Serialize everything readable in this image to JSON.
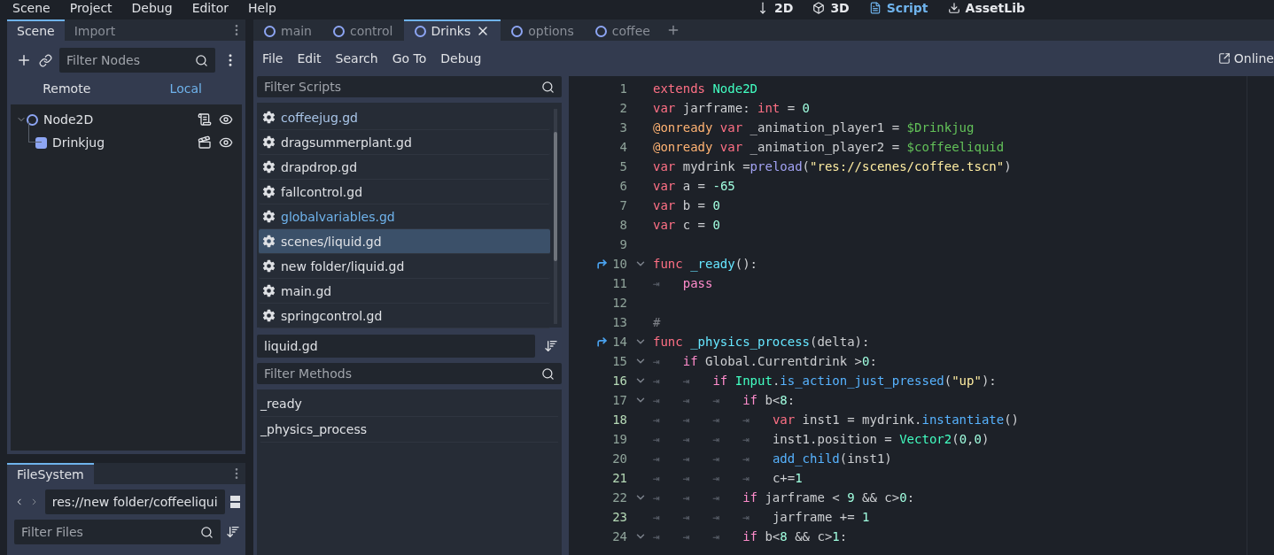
{
  "top_menu": [
    "Scene",
    "Project",
    "Debug",
    "Editor",
    "Help"
  ],
  "workspaces": [
    {
      "label": "2D",
      "kind": "canvas",
      "selected": false
    },
    {
      "label": "3D",
      "kind": "spatial",
      "selected": false
    },
    {
      "label": "Script",
      "kind": "script",
      "selected": true
    },
    {
      "label": "AssetLib",
      "kind": "assetlib",
      "selected": false
    }
  ],
  "scene_dock": {
    "tabs": [
      {
        "label": "Scene",
        "selected": true
      },
      {
        "label": "Import",
        "selected": false
      }
    ],
    "filter": {
      "placeholder": "Filter Nodes"
    },
    "modes": [
      {
        "label": "Remote",
        "selected": false
      },
      {
        "label": "Local",
        "selected": true
      }
    ],
    "tree": [
      {
        "name": "Node2D",
        "kind": "node2d",
        "has_script": true,
        "is_instance": false,
        "children": [
          {
            "name": "Drinkjug",
            "kind": "sprite",
            "has_script": false,
            "is_instance": true
          }
        ]
      }
    ]
  },
  "filesystem_dock": {
    "tabs": [
      {
        "label": "FileSystem",
        "selected": true
      }
    ],
    "path": "res://new folder/coffeeliqui",
    "filter": {
      "placeholder": "Filter Files"
    }
  },
  "script_tabs": [
    {
      "label": "main",
      "selected": false
    },
    {
      "label": "control",
      "selected": false
    },
    {
      "label": "Drinks",
      "selected": true
    },
    {
      "label": "options",
      "selected": false
    },
    {
      "label": "coffee",
      "selected": false
    }
  ],
  "script_menu": [
    "File",
    "Edit",
    "Search",
    "Go To",
    "Debug"
  ],
  "online_docs": "Online",
  "scripts_filter": {
    "placeholder": "Filter Scripts"
  },
  "scripts": [
    {
      "name": "coffeejug.gd",
      "color": "#a9c5e8",
      "selected": false
    },
    {
      "name": "dragsummerplant.gd",
      "color": "#dfe1e5",
      "selected": false
    },
    {
      "name": "drapdrop.gd",
      "color": "#dfe1e5",
      "selected": false
    },
    {
      "name": "fallcontrol.gd",
      "color": "#dfe1e5",
      "selected": false
    },
    {
      "name": "globalvariables.gd",
      "color": "#6fb3ec",
      "selected": false
    },
    {
      "name": "scenes/liquid.gd",
      "color": "#dfe1e5",
      "selected": true
    },
    {
      "name": "new folder/liquid.gd",
      "color": "#dfe1e5",
      "selected": false
    },
    {
      "name": "main.gd",
      "color": "#dfe1e5",
      "selected": false
    },
    {
      "name": "springcontrol.gd",
      "color": "#dfe1e5",
      "selected": false
    }
  ],
  "current_script": "liquid.gd",
  "methods_filter": {
    "placeholder": "Filter Methods"
  },
  "methods": [
    "_ready",
    "_physics_process"
  ],
  "code": [
    {
      "number": "1",
      "foldable": false,
      "connected": false,
      "modified": false,
      "tokens": [
        {
          "kind": "kw",
          "text": "extends"
        },
        {
          "kind": "type",
          "text": " Node2D"
        }
      ]
    },
    {
      "number": "2",
      "foldable": false,
      "connected": false,
      "modified": false,
      "tokens": [
        {
          "kind": "kw",
          "text": "var"
        },
        {
          "kind": "plain",
          "text": " jarframe: "
        },
        {
          "kind": "kw",
          "text": "int"
        },
        {
          "kind": "plain",
          "text": " = "
        },
        {
          "kind": "num",
          "text": "0"
        }
      ]
    },
    {
      "number": "3",
      "foldable": false,
      "connected": false,
      "modified": false,
      "tokens": [
        {
          "kind": "anno",
          "text": "@onready"
        },
        {
          "kind": "kw",
          "text": " var"
        },
        {
          "kind": "plain",
          "text": " _animation_player1 = "
        },
        {
          "kind": "path",
          "text": "$Drinkjug"
        }
      ]
    },
    {
      "number": "4",
      "foldable": false,
      "connected": false,
      "modified": false,
      "tokens": [
        {
          "kind": "anno",
          "text": "@onready"
        },
        {
          "kind": "kw",
          "text": " var"
        },
        {
          "kind": "plain",
          "text": " _animation_player2 = "
        },
        {
          "kind": "path",
          "text": "$coffeeliquid"
        }
      ]
    },
    {
      "number": "5",
      "foldable": false,
      "connected": false,
      "modified": false,
      "tokens": [
        {
          "kind": "kw",
          "text": "var"
        },
        {
          "kind": "plain",
          "text": " mydrink ="
        },
        {
          "kind": "builtin",
          "text": "preload"
        },
        {
          "kind": "plain",
          "text": "("
        },
        {
          "kind": "str",
          "text": "\"res://scenes/coffee.tscn\""
        },
        {
          "kind": "plain",
          "text": ")"
        }
      ]
    },
    {
      "number": "6",
      "foldable": false,
      "connected": false,
      "modified": false,
      "tokens": [
        {
          "kind": "kw",
          "text": "var"
        },
        {
          "kind": "plain",
          "text": " a = "
        },
        {
          "kind": "num",
          "text": "-65"
        }
      ]
    },
    {
      "number": "7",
      "foldable": false,
      "connected": false,
      "modified": false,
      "tokens": [
        {
          "kind": "kw",
          "text": "var"
        },
        {
          "kind": "plain",
          "text": " b = "
        },
        {
          "kind": "num",
          "text": "0"
        }
      ]
    },
    {
      "number": "8",
      "foldable": false,
      "connected": false,
      "modified": false,
      "tokens": [
        {
          "kind": "kw",
          "text": "var"
        },
        {
          "kind": "plain",
          "text": " c = "
        },
        {
          "kind": "num",
          "text": "0"
        }
      ]
    },
    {
      "number": "9",
      "foldable": false,
      "connected": false,
      "modified": false
    },
    {
      "number": "10",
      "foldable": true,
      "connected": true,
      "modified": false,
      "tokens": [
        {
          "kind": "kw",
          "text": "func"
        },
        {
          "kind": "fdef",
          "text": " _ready"
        },
        {
          "kind": "plain",
          "text": "():"
        }
      ]
    },
    {
      "number": "11",
      "foldable": false,
      "connected": false,
      "modified": false,
      "indent": "⇥",
      "tokens": [
        {
          "kind": "ctrl",
          "text": "pass"
        }
      ]
    },
    {
      "number": "12",
      "foldable": false,
      "connected": false,
      "modified": false
    },
    {
      "number": "13",
      "foldable": false,
      "connected": false,
      "modified": false,
      "tokens": [
        {
          "kind": "comment",
          "text": "#"
        }
      ]
    },
    {
      "number": "14",
      "foldable": true,
      "connected": true,
      "modified": false,
      "tokens": [
        {
          "kind": "kw",
          "text": "func"
        },
        {
          "kind": "fdef",
          "text": " _physics_process"
        },
        {
          "kind": "plain",
          "text": "(delta):"
        }
      ]
    },
    {
      "number": "15",
      "foldable": true,
      "connected": false,
      "modified": false,
      "indent": "⇥",
      "tokens": [
        {
          "kind": "ctrl",
          "text": "if"
        },
        {
          "kind": "plain",
          "text": " Global.Currentdrink >"
        },
        {
          "kind": "num",
          "text": "0"
        },
        {
          "kind": "plain",
          "text": ":"
        }
      ]
    },
    {
      "number": "16",
      "foldable": true,
      "connected": false,
      "modified": true,
      "indent": "⇥ ⇥",
      "tokens": [
        {
          "kind": "ctrl",
          "text": "if"
        },
        {
          "kind": "type",
          "text": " Input"
        },
        {
          "kind": "plain",
          "text": "."
        },
        {
          "kind": "fn",
          "text": "is_action_just_pressed"
        },
        {
          "kind": "plain",
          "text": "("
        },
        {
          "kind": "str",
          "text": "\"up\""
        },
        {
          "kind": "plain",
          "text": "):"
        }
      ]
    },
    {
      "number": "17",
      "foldable": true,
      "connected": false,
      "modified": false,
      "indent": "⇥ ⇥ ⇥",
      "tokens": [
        {
          "kind": "ctrl",
          "text": "if"
        },
        {
          "kind": "plain",
          "text": " b<"
        },
        {
          "kind": "num",
          "text": "8"
        },
        {
          "kind": "plain",
          "text": ":"
        }
      ]
    },
    {
      "number": "18",
      "foldable": false,
      "connected": false,
      "modified": true,
      "indent": "⇥ ⇥ ⇥ ⇥",
      "tokens": [
        {
          "kind": "kw",
          "text": "var"
        },
        {
          "kind": "plain",
          "text": " inst1 = mydrink."
        },
        {
          "kind": "fn",
          "text": "instantiate"
        },
        {
          "kind": "plain",
          "text": "()"
        }
      ]
    },
    {
      "number": "19",
      "foldable": false,
      "connected": false,
      "modified": false,
      "indent": "⇥ ⇥ ⇥ ⇥",
      "tokens": [
        {
          "kind": "plain",
          "text": "inst1.position = "
        },
        {
          "kind": "type",
          "text": "Vector2"
        },
        {
          "kind": "plain",
          "text": "("
        },
        {
          "kind": "num",
          "text": "0"
        },
        {
          "kind": "plain",
          "text": ","
        },
        {
          "kind": "num",
          "text": "0"
        },
        {
          "kind": "plain",
          "text": ")"
        }
      ]
    },
    {
      "number": "20",
      "foldable": false,
      "connected": false,
      "modified": false,
      "indent": "⇥ ⇥ ⇥ ⇥",
      "tokens": [
        {
          "kind": "fn",
          "text": "add_child"
        },
        {
          "kind": "plain",
          "text": "(inst1)"
        }
      ]
    },
    {
      "number": "21",
      "foldable": false,
      "connected": false,
      "modified": true,
      "indent": "⇥ ⇥ ⇥ ⇥",
      "tokens": [
        {
          "kind": "plain",
          "text": "c+="
        },
        {
          "kind": "num",
          "text": "1"
        }
      ]
    },
    {
      "number": "22",
      "foldable": true,
      "connected": false,
      "modified": false,
      "indent": "⇥ ⇥ ⇥",
      "tokens": [
        {
          "kind": "ctrl",
          "text": "if"
        },
        {
          "kind": "plain",
          "text": " jarframe < "
        },
        {
          "kind": "num",
          "text": "9"
        },
        {
          "kind": "plain",
          "text": " && c>"
        },
        {
          "kind": "num",
          "text": "0"
        },
        {
          "kind": "plain",
          "text": ":"
        }
      ]
    },
    {
      "number": "23",
      "foldable": false,
      "connected": false,
      "modified": true,
      "indent": "⇥ ⇥ ⇥ ⇥",
      "tokens": [
        {
          "kind": "plain",
          "text": "jarframe += "
        },
        {
          "kind": "num",
          "text": "1"
        }
      ]
    },
    {
      "number": "24",
      "foldable": true,
      "connected": false,
      "modified": false,
      "indent": "⇥ ⇥ ⇥",
      "tokens": [
        {
          "kind": "ctrl",
          "text": "if"
        },
        {
          "kind": "plain",
          "text": " b<"
        },
        {
          "kind": "num",
          "text": "8"
        },
        {
          "kind": "plain",
          "text": " && c>"
        },
        {
          "kind": "num",
          "text": "1"
        },
        {
          "kind": "plain",
          "text": ":"
        }
      ]
    }
  ]
}
